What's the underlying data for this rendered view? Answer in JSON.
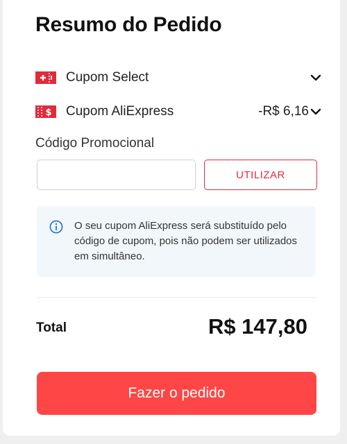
{
  "summary": {
    "title": "Resumo do Pedido"
  },
  "coupons": [
    {
      "icon": "coupon-plus-icon",
      "label": "Cupom Select",
      "value": ""
    },
    {
      "icon": "coupon-dollar-icon",
      "label": "Cupom AliExpress",
      "value": "-R$ 6,16"
    }
  ],
  "promo": {
    "label": "Código Promocional",
    "input_value": "",
    "input_placeholder": "",
    "apply_label": "UTILIZAR"
  },
  "notice": {
    "icon": "info-icon",
    "text": "O seu cupom AliExpress será substituído pelo código de cupom, pois não podem ser utilizados em simultâneo."
  },
  "total": {
    "label": "Total",
    "value": "R$ 147,80"
  },
  "order_button": {
    "label": "Fazer o pedido"
  },
  "colors": {
    "accent": "#fd4645",
    "coupon_red": "#e02b3c",
    "notice_bg": "#f2f7fc",
    "info_blue": "#1a6ed8"
  }
}
